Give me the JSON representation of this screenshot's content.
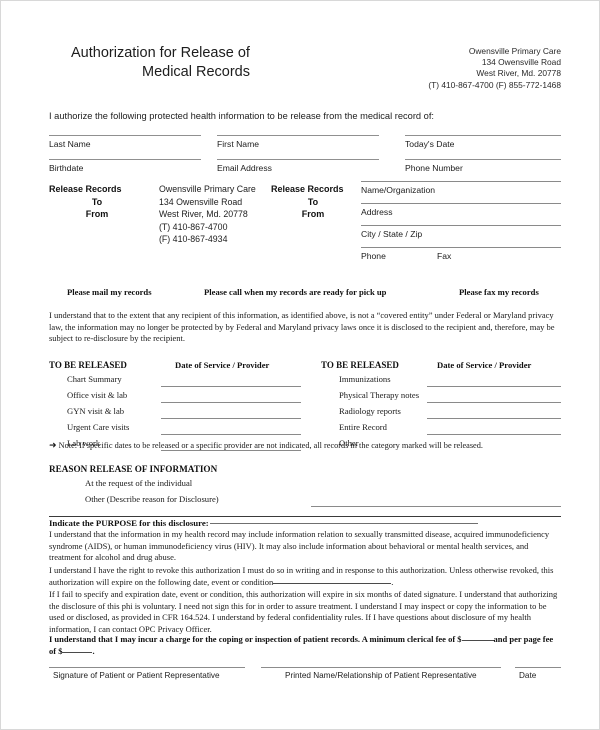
{
  "header": {
    "title_line1": "Authorization for Release of",
    "title_line2": "Medical Records",
    "clinic": {
      "name": "Owensville Primary Care",
      "street": "134 Owensville Road",
      "citystatezip": "West River, Md. 20778",
      "phones": "(T) 410-867-4700   (F) 855-772-1468"
    }
  },
  "intro": "I authorize the following protected health information to be release from the medical record of:",
  "identity_fields": {
    "row1": [
      "Last Name",
      "First Name",
      "Today's Date"
    ],
    "row2": [
      "Birthdate",
      "Email Address",
      "Phone Number"
    ]
  },
  "release": {
    "left_head": {
      "w1": "Release Records",
      "w2": "To",
      "w3": "From"
    },
    "right_head": {
      "w1": "Release Records",
      "w2": "To",
      "w3": "From"
    },
    "clinic_address": [
      "Owensville Primary Care",
      "134 Owensville Road",
      "West River, Md. 20778",
      "(T) 410-867-4700",
      "(F) 410-867-4934"
    ],
    "address_lines": [
      {
        "label": "Name/Organization",
        "label2": ""
      },
      {
        "label": "Address",
        "label2": ""
      },
      {
        "label": "City / State / Zip",
        "label2": ""
      },
      {
        "label": "Phone",
        "label2": "Fax"
      }
    ]
  },
  "please_row": [
    "Please mail my records",
    "Please call when my records are ready for pick up",
    "Please fax my records"
  ],
  "privacy_paragraph": "I understand that to the extent that any recipient of this information, as identified above, is not a “covered entity” under Federal or Maryland privacy law, the information may no longer be protected by by Federal and Maryland privacy laws once it is disclosed to the recipient and, therefore, may be subject to re-disclosure by the recipient.",
  "to_be_released": {
    "left": {
      "title": "TO BE RELEASED",
      "date_header": "Date of Service / Provider",
      "items": [
        "Chart Summary",
        "Office visit & lab",
        "GYN visit & lab",
        "Urgent Care visits",
        "Lab work"
      ]
    },
    "right": {
      "title": "TO BE RELEASED",
      "date_header": "Date of Service / Provider",
      "items": [
        "Immunizations",
        "Physical Therapy notes",
        "Radiology reports",
        "Entire Record",
        "Other"
      ]
    }
  },
  "note": {
    "arrow": "➜",
    "text": "Note: If specific dates to be released or a specific provider are not indicated, all records in the category marked will be released."
  },
  "reason": {
    "title": "REASON RELEASE OF INFORMATION",
    "item1": "At the request of the individual",
    "item2": "Other (Describe reason for Disclosure)"
  },
  "purpose": {
    "heading": "Indicate the PURPOSE for this disclosure:",
    "para_a": "I understand that the information in my health record may include information relation to sexually transmitted disease, acquired immunodeficiency syndrome (AIDS), or human immunodeficiency virus (HIV). It may also include information about behavioral or mental health services, and treatment for alcohol and drug abuse.",
    "para_b_pre": "I understand I have the right to revoke this authorization I must do so in writing and in response to this authorization. Unless otherwise revoked, this authorization will expire on the following date, event or condition",
    "para_b_post": ".",
    "para_c": "If I fail to specify and expiration date, event or condition, this authorization will expire in six months of dated signature. I understand that authorizing the disclosure of this phi is voluntary. I need not sign this for in order to assure treatment. I understand I may inspect or copy the information to be used or disclosed, as provided in CFR 164.524. I understand by federal confidentiality rules. If I have questions about disclosure of my health information, I can contact OPC Privacy Officer.",
    "fee_pre": "I understand that I may incur a charge for the coping or inspection of patient records. A minimum clerical fee of $",
    "fee_mid": "and per page fee of $",
    "fee_post": "."
  },
  "signature": {
    "field1": "Signature of Patient or Patient Representative",
    "field2": "Printed Name/Relationship of Patient Representative",
    "field3": "Date"
  }
}
